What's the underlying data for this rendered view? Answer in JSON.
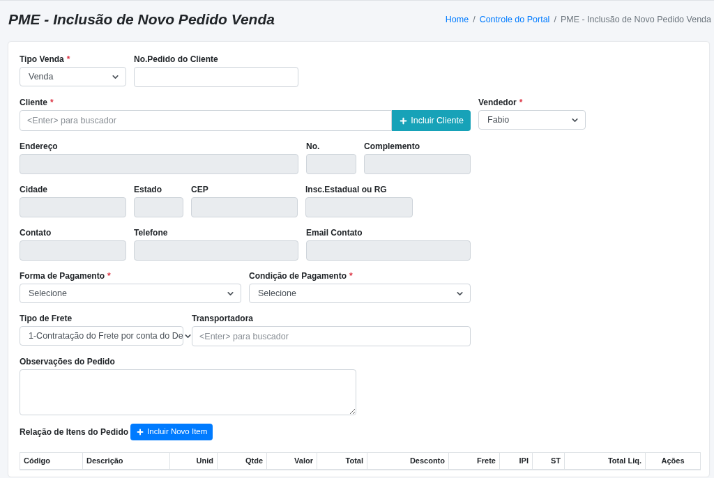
{
  "page_title": "PME - Inclusão de Novo Pedido Venda",
  "breadcrumb": [
    {
      "label": "Home",
      "link": true
    },
    {
      "separator": "/",
      "label": "Controle do Portal",
      "link": true
    },
    {
      "separator": "/",
      "label": "PME - Inclusão de Novo Pedido Venda",
      "link": false
    }
  ],
  "form_rows": [
    [
      {
        "kind": "select",
        "label": "Tipo Venda",
        "required_mark": "*",
        "value": "Venda"
      },
      {
        "kind": "input",
        "label": "No.Pedido do Cliente"
      }
    ],
    [
      {
        "kind": "search",
        "label": "Cliente",
        "required_mark": "*",
        "placeholder": "<Enter> para buscador",
        "button": "Incluir Cliente"
      },
      {
        "kind": "select",
        "label": "Vendedor",
        "required_mark": "*",
        "value": "Fabio"
      }
    ],
    [
      {
        "kind": "readonly",
        "label": "Endereço"
      },
      {
        "kind": "readonly",
        "label": "No."
      },
      {
        "kind": "readonly",
        "label": "Complemento"
      }
    ],
    [
      {
        "kind": "readonly",
        "label": "Cidade"
      },
      {
        "kind": "readonly",
        "label": "Estado"
      },
      {
        "kind": "readonly",
        "label": "CEP"
      },
      {
        "kind": "readonly",
        "label": "Insc.Estadual ou RG"
      }
    ],
    [
      {
        "kind": "readonly",
        "label": "Contato"
      },
      {
        "kind": "readonly",
        "label": "Telefone"
      },
      {
        "kind": "readonly",
        "label": "Email Contato"
      }
    ],
    [
      {
        "kind": "select",
        "label": "Forma de Pagamento",
        "required_mark": "*",
        "value": "Selecione"
      },
      {
        "kind": "select",
        "label": "Condição de Pagamento",
        "required_mark": "*",
        "value": "Selecione"
      }
    ],
    [
      {
        "kind": "select",
        "label": "Tipo de Frete",
        "value": "1-Contratação do Frete por conta do De"
      },
      {
        "kind": "input",
        "label": "Transportadora",
        "placeholder": "<Enter> para buscador"
      }
    ],
    [
      {
        "kind": "textarea",
        "label": "Observações do Pedido"
      }
    ]
  ],
  "items_section": {
    "title": "Relação de Itens do Pedido",
    "button": "Incluir Novo Item"
  },
  "table": {
    "columns": [
      "Código",
      "Descrição",
      "Unid",
      "Qtde",
      "Valor",
      "Total",
      "Desconto",
      "Frete",
      "IPI",
      "ST",
      "Total Liq.",
      "Ações"
    ]
  }
}
